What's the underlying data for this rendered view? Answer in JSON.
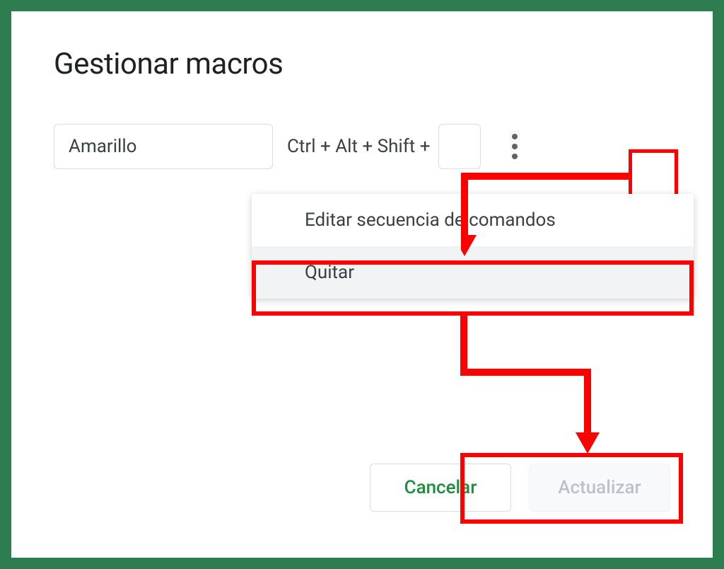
{
  "dialog": {
    "title": "Gestionar macros",
    "macro": {
      "name": "Amarillo",
      "shortcut_prefix": "Ctrl + Alt + Shift +",
      "shortcut_key": ""
    },
    "menu": {
      "edit_script": "Editar secuencia de comandos",
      "remove": "Quitar"
    },
    "actions": {
      "cancel": "Cancelar",
      "update": "Actualizar"
    }
  },
  "annotations": {
    "highlight_color": "#ff0000"
  }
}
